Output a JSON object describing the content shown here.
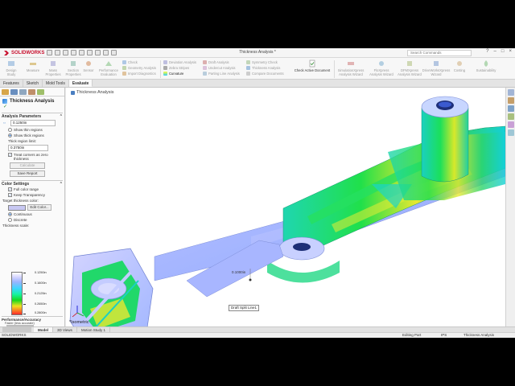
{
  "titlebar": {
    "brand": "SOLIDWORKS",
    "window_title": "Thickness Analysis *",
    "search_placeholder": "Search Commands"
  },
  "ribbon": {
    "left_buttons": [
      {
        "label": "Design Study",
        "icon": "design-study-icon"
      },
      {
        "label": "Measure",
        "icon": "measure-icon"
      },
      {
        "label": "Mass Properties",
        "icon": "mass-properties-icon"
      },
      {
        "label": "Section Properties",
        "icon": "section-properties-icon"
      },
      {
        "label": "Sensor",
        "icon": "sensor-icon"
      },
      {
        "label": "Performance Evaluation",
        "icon": "performance-evaluation-icon"
      }
    ],
    "check_group": [
      "Check",
      "Geometry Analysis",
      "Import Diagnostics"
    ],
    "analysis_group_1": [
      "Deviation Analysis",
      "Zebra Stripes",
      "Curvature"
    ],
    "analysis_group_2": [
      "Draft Analysis",
      "Undercut Analysis",
      "Parting Line Analysis"
    ],
    "analysis_group_3": [
      "Symmetry Check",
      "Thickness Analysis",
      "Compare Documents"
    ],
    "check_active": "Check Active Document",
    "right_buttons": [
      {
        "label": "SimulationXpress Analysis Wizard",
        "icon": "simulationxpress-icon"
      },
      {
        "label": "FloXpress Analysis Wizard",
        "icon": "floxpress-icon"
      },
      {
        "label": "DFMXpress Analysis Wizard",
        "icon": "dfmxpress-icon"
      },
      {
        "label": "DriveWorksXpress Wizard",
        "icon": "driveworksxpress-icon"
      },
      {
        "label": "Costing",
        "icon": "costing-icon"
      },
      {
        "label": "Sustainability",
        "icon": "sustainability-icon"
      }
    ]
  },
  "tabs": [
    "Features",
    "Sketch",
    "Mold Tools",
    "Evaluate"
  ],
  "panel": {
    "title": "Thickness Analysis",
    "analysis_parameters": "Analysis Parameters",
    "target_thickness": "0.1250in",
    "show_thin": "Show thin regions",
    "show_thick": "Show thick regions",
    "thick_limit_label": "Thick region limit:",
    "thick_limit": "0.3750in",
    "treat_corners": "Treat corners as zero thickness",
    "calculate": "Calculate",
    "save_report": "Save Report",
    "color_settings": "Color Settings",
    "full_color": "Full color range",
    "keep_transparency": "Keep Transparency",
    "target_color": "Target thickness color:",
    "edit_color": "Edit Color...",
    "continuous": "Continuous",
    "discrete": "Discrete",
    "thickness_scale": "Thickness scale:",
    "scale_values": [
      "0.1250in",
      "0.1600in",
      "0.2125in",
      "0.2650in",
      "0.2800in"
    ],
    "performance": "Performance/Accuracy",
    "perf_note": "Faster (less accurate)"
  },
  "viewport": {
    "tree_label": "Thickness Analysis",
    "view_name": "*Isometric",
    "dimension": "0.1000in",
    "split_label": "Draft Split Line1"
  },
  "bottom_tabs": [
    "Model",
    "3D Views",
    "Motion Study 1"
  ],
  "status": {
    "left": "SOLIDWORKS",
    "editing": "Editing Part",
    "units": "IPS",
    "right": "Thickness Analysis"
  }
}
